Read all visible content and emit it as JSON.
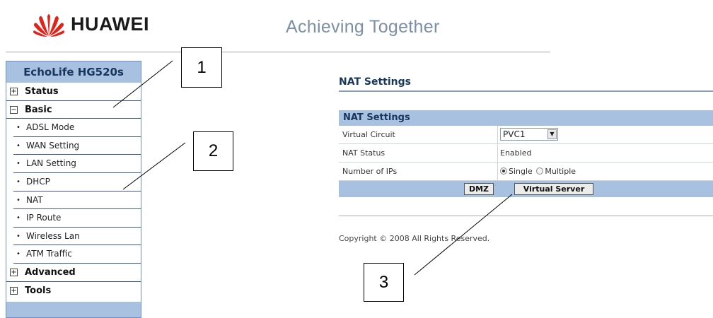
{
  "brand": {
    "logo_text": "HUAWEI",
    "slogan": "Achieving Together",
    "accent": "#e2231a"
  },
  "sidebar": {
    "title": "EchoLife HG520s",
    "items": [
      {
        "label": "Status",
        "expander": "+"
      },
      {
        "label": "Basic",
        "expander": "−"
      },
      {
        "label": "ADSL Mode"
      },
      {
        "label": "WAN Setting"
      },
      {
        "label": "LAN Setting"
      },
      {
        "label": "DHCP"
      },
      {
        "label": "NAT"
      },
      {
        "label": "IP Route"
      },
      {
        "label": "Wireless Lan"
      },
      {
        "label": "ATM Traffic"
      },
      {
        "label": "Advanced",
        "expander": "+"
      },
      {
        "label": "Tools",
        "expander": "+"
      }
    ],
    "bullet": "•"
  },
  "main": {
    "heading": "NAT Settings",
    "panel": {
      "title": "NAT Settings",
      "virtual_circuit": {
        "label": "Virtual Circuit",
        "value": "PVC1"
      },
      "nat_status": {
        "label": "NAT Status",
        "value": "Enabled"
      },
      "number_of_ips": {
        "label": "Number of IPs",
        "option_single": "Single",
        "option_multiple": "Multiple",
        "selected": "Single"
      },
      "buttons": {
        "dmz": "DMZ",
        "virtual_server": "Virtual Server"
      }
    },
    "copyright": "Copyright © 2008 All Rights Reserved."
  },
  "callouts": {
    "one": "1",
    "two": "2",
    "three": "3"
  },
  "icons": {
    "logo": "huawei-petal-logo",
    "dropdown": "chevron-down-icon",
    "expand": "plus-box-icon",
    "collapse": "minus-box-icon"
  },
  "colors": {
    "sidebar_header": "#a9c1e0",
    "heading_text": "#17365d",
    "slogan": "#7b90a6"
  }
}
